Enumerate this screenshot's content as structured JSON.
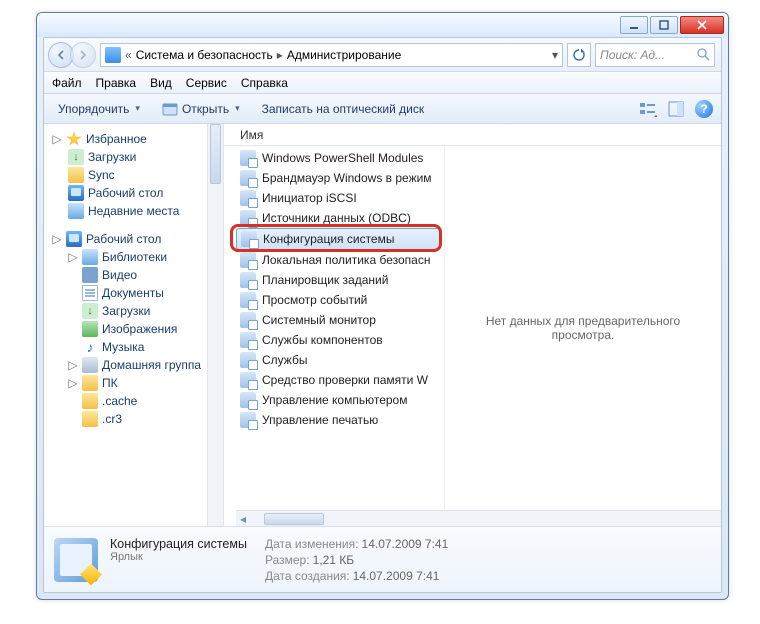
{
  "window": {
    "min_tip": "Minimize",
    "max_tip": "Restore",
    "close_tip": "Close"
  },
  "breadcrumb": {
    "seg1": "Система и безопасность",
    "seg2": "Администрирование"
  },
  "search": {
    "placeholder": "Поиск: Ад..."
  },
  "menu": {
    "file": "Файл",
    "edit": "Правка",
    "view": "Вид",
    "tools": "Сервис",
    "help": "Справка"
  },
  "toolbar": {
    "organize": "Упорядочить",
    "open": "Открыть",
    "burn": "Записать на оптический диск"
  },
  "tree": {
    "favorites": "Избранное",
    "downloads": "Загрузки",
    "sync": "Sync",
    "desktop": "Рабочий стол",
    "recent": "Недавние места",
    "desktop2": "Рабочий стол",
    "libs": "Библиотеки",
    "video": "Видео",
    "docs": "Документы",
    "downloads2": "Загрузки",
    "images": "Изображения",
    "music": "Музыка",
    "homegroup": "Домашняя группа",
    "pc": "ПК",
    "cache": ".cache",
    "cr3": ".cr3"
  },
  "column": {
    "name": "Имя"
  },
  "files": [
    "Windows PowerShell Modules",
    "Брандмауэр Windows в режим",
    "Инициатор iSCSI",
    "Источники данных (ODBC)",
    "Конфигурация системы",
    "Локальная политика безопасн",
    "Планировщик заданий",
    "Просмотр событий",
    "Системный монитор",
    "Службы компонентов",
    "Службы",
    "Средство проверки памяти W",
    "Управление компьютером",
    "Управление печатью"
  ],
  "selected_index": 4,
  "preview": {
    "empty": "Нет данных для предварительного просмотра."
  },
  "details": {
    "title": "Конфигурация системы",
    "type": "Ярлык",
    "mod_label": "Дата изменения:",
    "mod_value": "14.07.2009 7:41",
    "size_label": "Размер:",
    "size_value": "1,21 КБ",
    "created_label": "Дата создания:",
    "created_value": "14.07.2009 7:41"
  }
}
